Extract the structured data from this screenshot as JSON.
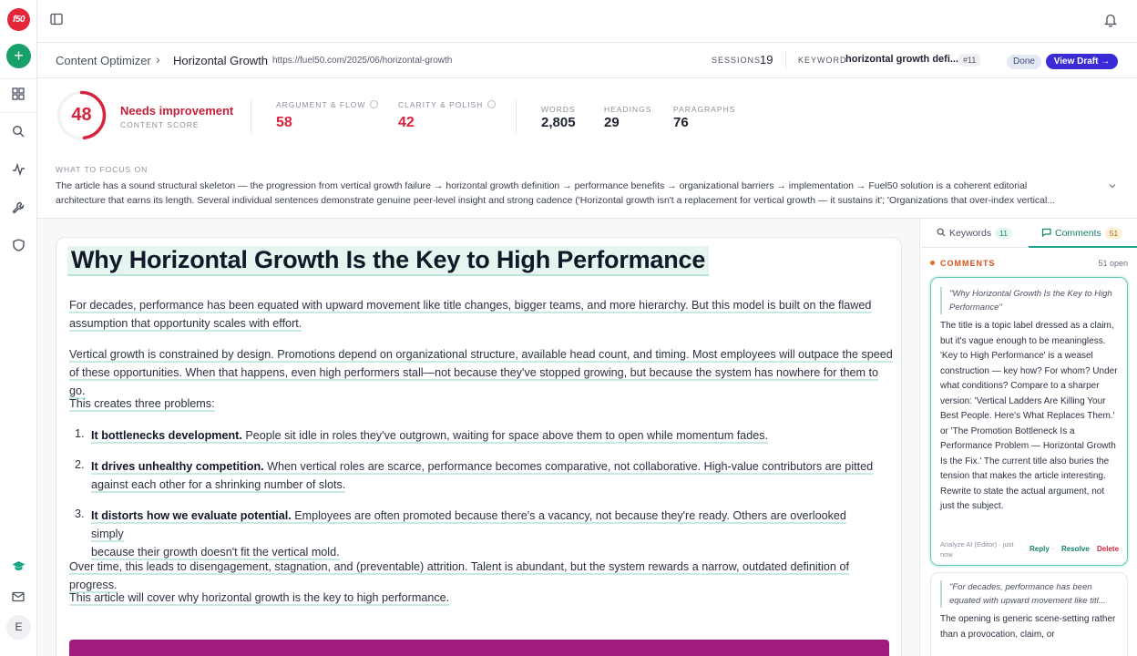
{
  "app": {
    "logo_text": "f50",
    "avatar_initial": "E",
    "accent": "#17a48a",
    "brand": "#e3263a",
    "primary_button_color": "#3b2bd6"
  },
  "rail": {
    "icons": [
      "plus-icon",
      "dashboard-icon",
      "search-icon",
      "activity-icon",
      "wrench-icon",
      "shield-icon",
      "graduation-cap-icon",
      "mail-icon"
    ]
  },
  "header": {
    "crumb_root": "Content Optimizer",
    "crumb_sep": "›",
    "crumb_page": "Horizontal Growth",
    "url": "https://fuel50.com/2025/06/horizontal-growth",
    "sessions_label": "SESSIONS",
    "sessions_value": "19",
    "keyword_label": "KEYWORD",
    "keyword_value": "horizontal growth defi...",
    "keyword_rank": "#11",
    "done_label": "Done",
    "view_draft_label": "View Draft →"
  },
  "score": {
    "value": "48",
    "fraction": 0.48,
    "status": "Needs improvement",
    "sub": "CONTENT SCORE",
    "argument_label": "ARGUMENT & FLOW",
    "argument_value": "58",
    "clarity_label": "CLARITY & POLISH",
    "clarity_value": "42",
    "words_label": "WORDS",
    "words_value": "2,805",
    "headings_label": "HEADINGS",
    "headings_value": "29",
    "paragraphs_label": "PARAGRAPHS",
    "paragraphs_value": "76"
  },
  "focus": {
    "label": "WHAT TO FOCUS ON",
    "line1": "The article has a sound structural skeleton — the progression from vertical growth failure → horizontal growth definition → performance benefits → organizational barriers → implementation → Fuel50 solution is a coherent editorial",
    "line2": "architecture that earns its length. Several individual sentences demonstrate genuine peer-level insight and strong cadence ('Horizontal growth isn't a replacement for vertical growth — it sustains it'; 'Organizations that over-index vertical..."
  },
  "article": {
    "title": "Why Horizontal Growth Is the Key to High Performance",
    "p1a": "For decades, performance has been equated with upward movement like title changes, bigger teams, and more hierarchy. But this model is built on the flawed",
    "p1b": "assumption that opportunity scales with effort.",
    "p2a": "Vertical growth is constrained by design. Promotions depend on organizational structure, available head count, and timing. Most employees will outpace the speed",
    "p2b": "of these opportunities. When that happens, even high performers stall—not because they've stopped growing, but because the system has nowhere for them to go.",
    "p3": "This creates three problems:",
    "items": [
      {
        "num": "1.",
        "bold": "It bottlenecks development.",
        "rest_a": " People sit idle in roles they've outgrown, waiting for space above them to open while momentum fades.",
        "rest_b": ""
      },
      {
        "num": "2.",
        "bold": "It drives unhealthy competition.",
        "rest_a": " When vertical roles are scarce, performance becomes comparative, not collaborative. High-value contributors are pitted",
        "rest_b": "against each other for a shrinking number of slots."
      },
      {
        "num": "3.",
        "bold": "It distorts how we evaluate potential.",
        "rest_a": " Employees are often promoted because there's a vacancy, not because they're ready. Others are overlooked simply",
        "rest_b": "because their growth doesn't fit the vertical mold."
      }
    ],
    "p4": "Over time, this leads to disengagement, stagnation, and (preventable) attrition. Talent is abundant, but the system rewards a narrow, outdated definition of progress.",
    "p5": "This article will cover why horizontal growth is the key to high performance."
  },
  "panel": {
    "tab_keywords": "Keywords",
    "tab_keywords_count": "11",
    "tab_comments": "Comments",
    "tab_comments_count": "51",
    "comments_heading": "COMMENTS",
    "open_count": "51 open",
    "c1_quote": "\"Why Horizontal Growth Is the Key to High Performance\"",
    "c1_body": "The title is a topic label dressed as a claim, but it's vague enough to be meaningless. 'Key to High Performance' is a weasel construction — key how? For whom? Under what conditions? Compare to a sharper version: 'Vertical Ladders Are Killing Your Best People. Here's What Replaces Them.' or 'The Promotion Bottleneck Is a Performance Problem — Horizontal Growth Is the Fix.' The current title also buries the tension that makes the article interesting. Rewrite to state the actual argument, not just the subject.",
    "c1_author": "Analyze AI (Editor) · just now",
    "reply": "Reply",
    "resolve": "Resolve",
    "delete": "Delete",
    "c2_quote": "\"For decades, performance has been equated with upward movement like titl...",
    "c2_body": "The opening is generic scene-setting rather than a provocation, claim, or"
  }
}
